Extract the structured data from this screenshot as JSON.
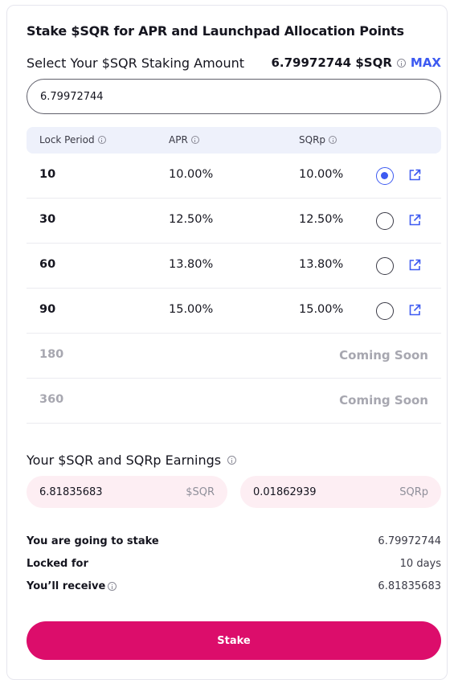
{
  "card": {
    "title": "Stake $SQR for APR and Launchpad Allocation Points"
  },
  "amount": {
    "label": "Select Your $SQR Staking Amount",
    "balance": "6.79972744 $SQR",
    "max_label": "MAX",
    "input_value": "6.79972744"
  },
  "table": {
    "headers": [
      "Lock Period",
      "APR",
      "SQRp"
    ],
    "rows": [
      {
        "period": "10",
        "apr": "10.00%",
        "sqrp": "10.00%",
        "selected": true
      },
      {
        "period": "30",
        "apr": "12.50%",
        "sqrp": "12.50%",
        "selected": false
      },
      {
        "period": "60",
        "apr": "13.80%",
        "sqrp": "13.80%",
        "selected": false
      },
      {
        "period": "90",
        "apr": "15.00%",
        "sqrp": "15.00%",
        "selected": false
      }
    ],
    "disabled_rows": [
      {
        "period": "180",
        "status": "Coming Soon"
      },
      {
        "period": "360",
        "status": "Coming Soon"
      }
    ]
  },
  "earnings": {
    "title": "Your $SQR and SQRp Earnings",
    "sqr_value": "6.81835683",
    "sqr_unit": "$SQR",
    "sqrp_value": "0.01862939",
    "sqrp_unit": "SQRp"
  },
  "summary": {
    "stake_label": "You are going to stake",
    "stake_value": "6.79972744",
    "locked_label": "Locked for",
    "locked_value": "10 days",
    "receive_label": "You’ll receive",
    "receive_value": "6.81835683"
  },
  "stake_button": "Stake",
  "colors": {
    "accent": "#3d5af1",
    "primary_button": "#dc0d6b",
    "earn_bg": "#fdeef3",
    "header_bg": "#eef1fb"
  }
}
